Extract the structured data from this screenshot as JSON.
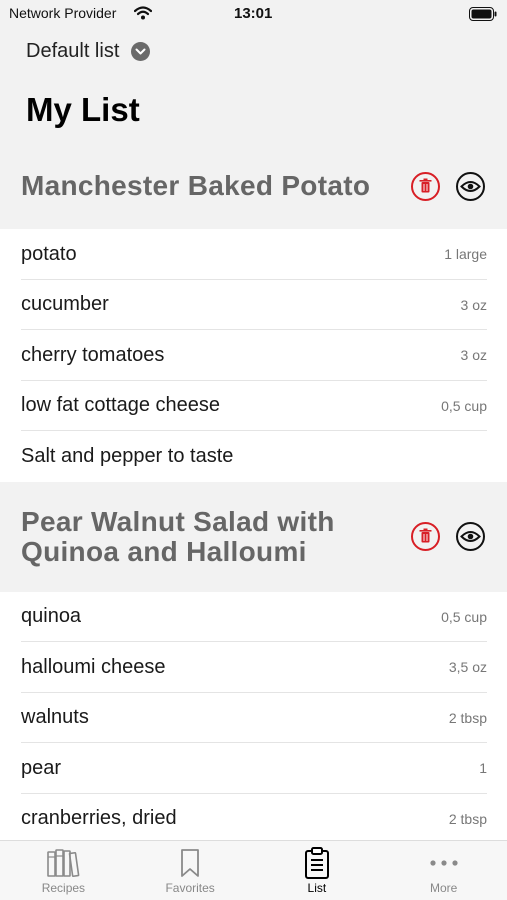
{
  "status": {
    "carrier": "Network Provider",
    "time": "13:01"
  },
  "header": {
    "list_selector": "Default list",
    "title": "My List"
  },
  "recipes": [
    {
      "title_lines": [
        "Manchester Baked Potato"
      ],
      "ingredients": [
        {
          "name": "potato",
          "qty": "1 large"
        },
        {
          "name": "cucumber",
          "qty": "3 oz"
        },
        {
          "name": "cherry tomatoes",
          "qty": "3 oz"
        },
        {
          "name": "low fat cottage cheese",
          "qty": "0,5 cup"
        },
        {
          "name": "Salt and pepper to taste",
          "qty": ""
        }
      ]
    },
    {
      "title_lines": [
        "Pear Walnut Salad with",
        "Quinoa and Halloumi"
      ],
      "ingredients": [
        {
          "name": "quinoa",
          "qty": "0,5 cup"
        },
        {
          "name": "halloumi cheese",
          "qty": "3,5 oz"
        },
        {
          "name": "walnuts",
          "qty": "2 tbsp"
        },
        {
          "name": "pear",
          "qty": "1"
        },
        {
          "name": "cranberries, dried",
          "qty": "2 tbsp"
        }
      ]
    }
  ],
  "tabs": [
    {
      "label": "Recipes",
      "icon": "books-icon",
      "active": false
    },
    {
      "label": "Favorites",
      "icon": "bookmark-icon",
      "active": false
    },
    {
      "label": "List",
      "icon": "clipboard-list-icon",
      "active": true
    },
    {
      "label": "More",
      "icon": "more-dots-icon",
      "active": false
    }
  ],
  "colors": {
    "delete_red": "#d81f26",
    "header_bg": "#f2f2f2",
    "recipe_title": "#666666"
  }
}
